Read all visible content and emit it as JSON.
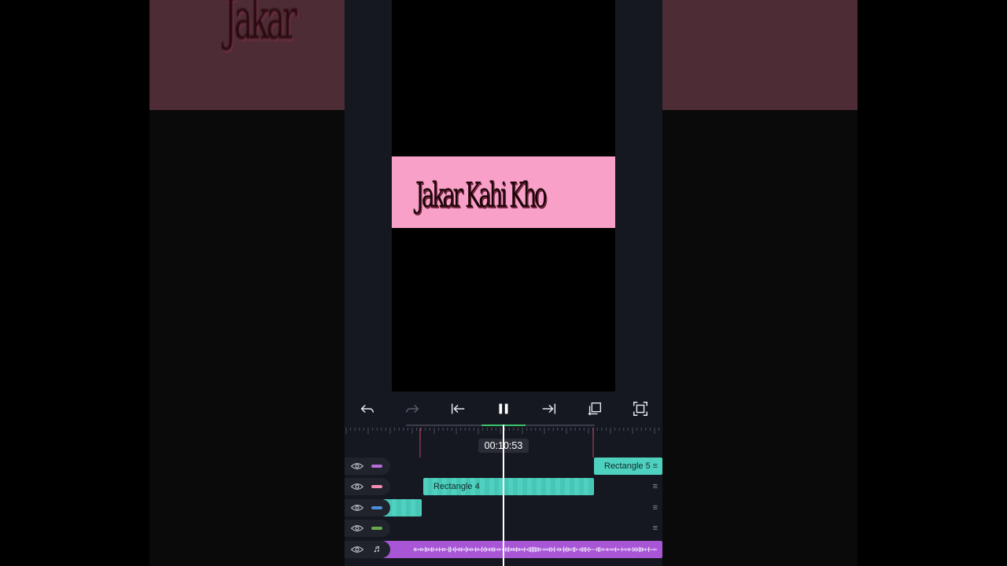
{
  "preview": {
    "title_text": "Jakar Kahi Kho",
    "background_text": "Jakar"
  },
  "toolbar": {
    "undo": "undo-icon",
    "redo": "redo-icon",
    "skip_start": "skip-start-icon",
    "pause": "pause-icon",
    "skip_end": "skip-end-icon",
    "copy": "duplicate-icon",
    "fullscreen": "fullscreen-icon"
  },
  "timeline": {
    "current_time": "00:10:53",
    "tracks": [
      {
        "name": "Rectangle 5",
        "swatch": "#b86bd8"
      },
      {
        "name": "Rectangle 4",
        "swatch": "#f38db5"
      },
      {
        "name": "",
        "swatch": "#4a8fd8"
      },
      {
        "name": "",
        "swatch": "#6aa84f"
      },
      {
        "name": "",
        "icon": "music-note-icon",
        "swatch": "#b56ce0"
      }
    ]
  },
  "colors": {
    "accent_teal": "#4fd1bf",
    "audio_purple": "#b05ee0",
    "pink_rect": "#f8a0c8"
  }
}
